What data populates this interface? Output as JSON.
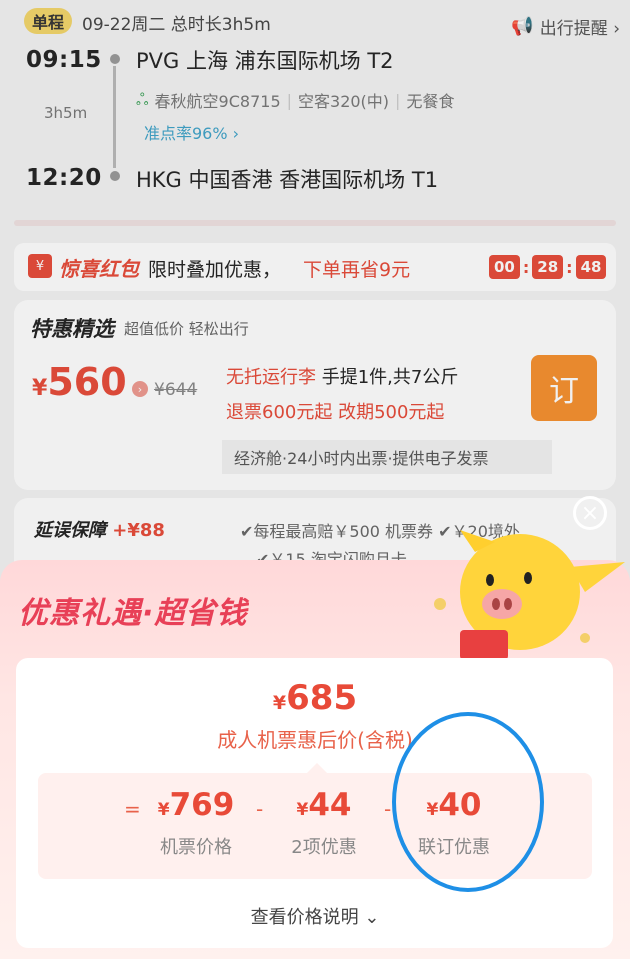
{
  "flight": {
    "oneway_tag": "单程",
    "date_info": "09-22周二  总时长3h5m",
    "reminder_label": "出行提醒 ›",
    "depart_time": "09:15",
    "depart_airport": "PVG 上海 浦东国际机场 T2",
    "duration": "3h5m",
    "airline": "春秋航空9C8715",
    "aircraft": "空客320(中)",
    "meal": "无餐食",
    "ontime": "准点率96% ›",
    "arrive_time": "12:20",
    "arrive_airport": "HKG 中国香港 香港国际机场 T1"
  },
  "redpacket": {
    "title": "惊喜红包",
    "desc": "限时叠加优惠，",
    "save": "下单再省9元",
    "timer": [
      "00",
      "28",
      "48"
    ]
  },
  "deal": {
    "title": "特惠精选",
    "subtitle": "超值低价 轻松出行",
    "price_symbol": "¥",
    "price": "560",
    "old_price": "¥644",
    "baggage_red": "无托运行李",
    "baggage": "手提1件,共7公斤",
    "refund": "退票600元起 改期500元起",
    "book_label": "订",
    "tags": "经济舱·24小时内出票·提供电子发票"
  },
  "delay": {
    "title": "延误保障",
    "price": "+¥88",
    "perk1": "✔每程最高赔￥500 机票券 ✔￥20境外",
    "perk2": "✔￥15 淘宝闪购月卡"
  },
  "sheet": {
    "title": "优惠礼遇·超省钱",
    "final_symbol": "¥",
    "final_price": "685",
    "final_label": "成人机票惠后价(含税)",
    "items": [
      {
        "op": "=",
        "symbol": "¥",
        "amount": "769",
        "label": "机票价格"
      },
      {
        "op": "-",
        "symbol": "¥",
        "amount": "44",
        "label": "2项优惠"
      },
      {
        "op": "-",
        "symbol": "¥",
        "amount": "40",
        "label": "联订优惠"
      }
    ],
    "explain": "查看价格说明 ⌄"
  },
  "colors": {
    "accent": "#e84a38",
    "orange": "#f7902d",
    "ring": "#1e8fe6"
  }
}
